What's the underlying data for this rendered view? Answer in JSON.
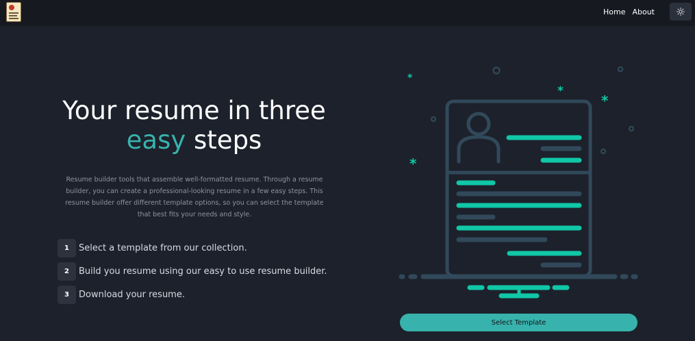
{
  "nav": {
    "links": [
      "Home",
      "About"
    ],
    "theme_toggle_icon": "sun-icon"
  },
  "hero": {
    "title_line1": "Your resume in three",
    "title_accent": "easy",
    "title_rest": " steps",
    "description": "Resume builder tools that assemble well-formatted resume. Through a resume builder, you can create a professional-looking resume in a few easy steps. This resume builder offer different template options, so you can select the template that best fits your needs and style."
  },
  "steps": [
    {
      "num": "1",
      "text": "Select a template from our collection."
    },
    {
      "num": "2",
      "text": "Build you resume using our easy to use resume builder."
    },
    {
      "num": "3",
      "text": "Download your resume."
    }
  ],
  "cta": {
    "label": "Select Template"
  },
  "colors": {
    "background": "#1c212b",
    "navbar": "#161a20",
    "accent": "#38b2ac",
    "illustration_teal": "#10c7a7",
    "illustration_slate": "#31495a"
  },
  "icons": {
    "logo": "resume-logo-icon",
    "illustration": "resume-illustration"
  }
}
